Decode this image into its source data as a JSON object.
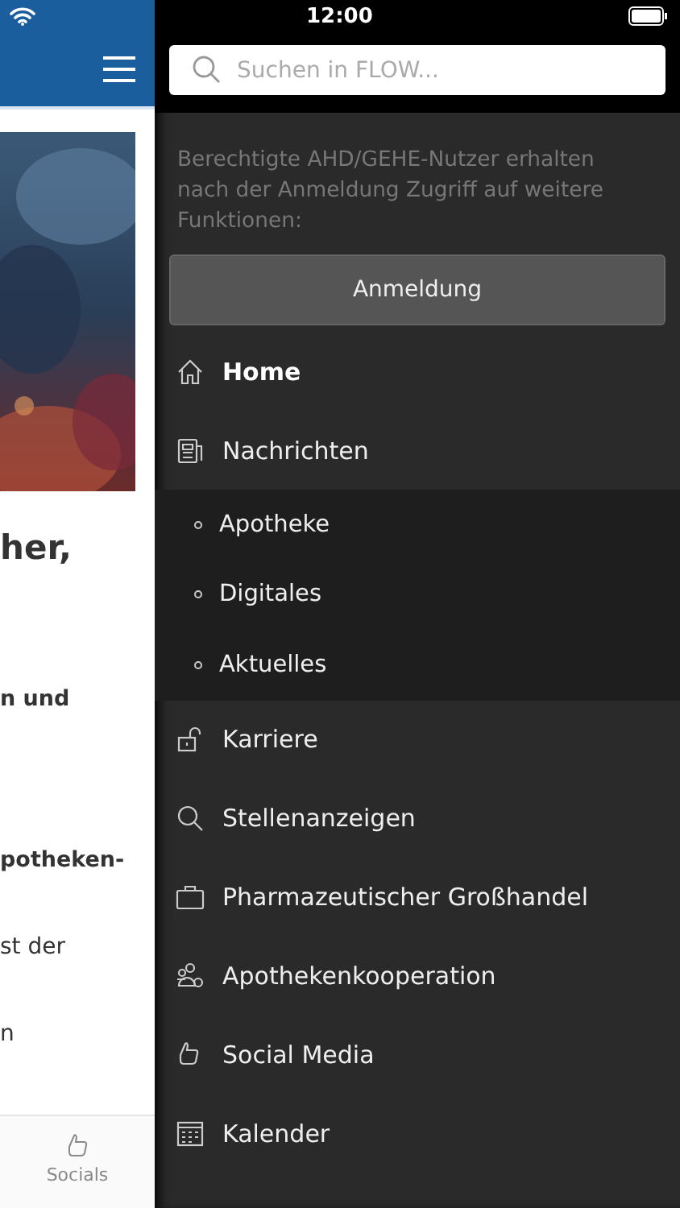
{
  "status_bar": {
    "time": "12:00"
  },
  "background_page": {
    "fragments": [
      {
        "text": "her,",
        "kind": "heading"
      },
      {
        "text": "n und",
        "kind": "bold"
      },
      {
        "text": "potheken-",
        "kind": "bold"
      },
      {
        "text": "st der",
        "kind": "text"
      },
      {
        "text": "n",
        "kind": "text"
      }
    ],
    "tab_bar": {
      "label": "Socials"
    }
  },
  "drawer": {
    "search": {
      "placeholder": "Suchen in FLOW..."
    },
    "notice": "Berechtigte AHD/GEHE-Nutzer erhalten nach der Anmeldung Zugriff auf weitere Funktionen:",
    "login_button": "Anmeldung",
    "menu": [
      {
        "label": "Home",
        "selected": true
      },
      {
        "label": "Nachrichten",
        "selected": false,
        "expanded": true,
        "children": [
          {
            "label": "Apotheke",
            "selected": false
          },
          {
            "label": "Digitales",
            "selected": false
          },
          {
            "label": "Aktuelles",
            "selected": false
          }
        ]
      },
      {
        "label": "Karriere",
        "selected": false
      },
      {
        "label": "Stellenanzeigen",
        "selected": false
      },
      {
        "label": "Pharmazeutischer Großhandel",
        "selected": false
      },
      {
        "label": "Apothekenkooperation",
        "selected": false
      },
      {
        "label": "Social Media",
        "selected": false
      },
      {
        "label": "Kalender",
        "selected": false
      }
    ]
  }
}
